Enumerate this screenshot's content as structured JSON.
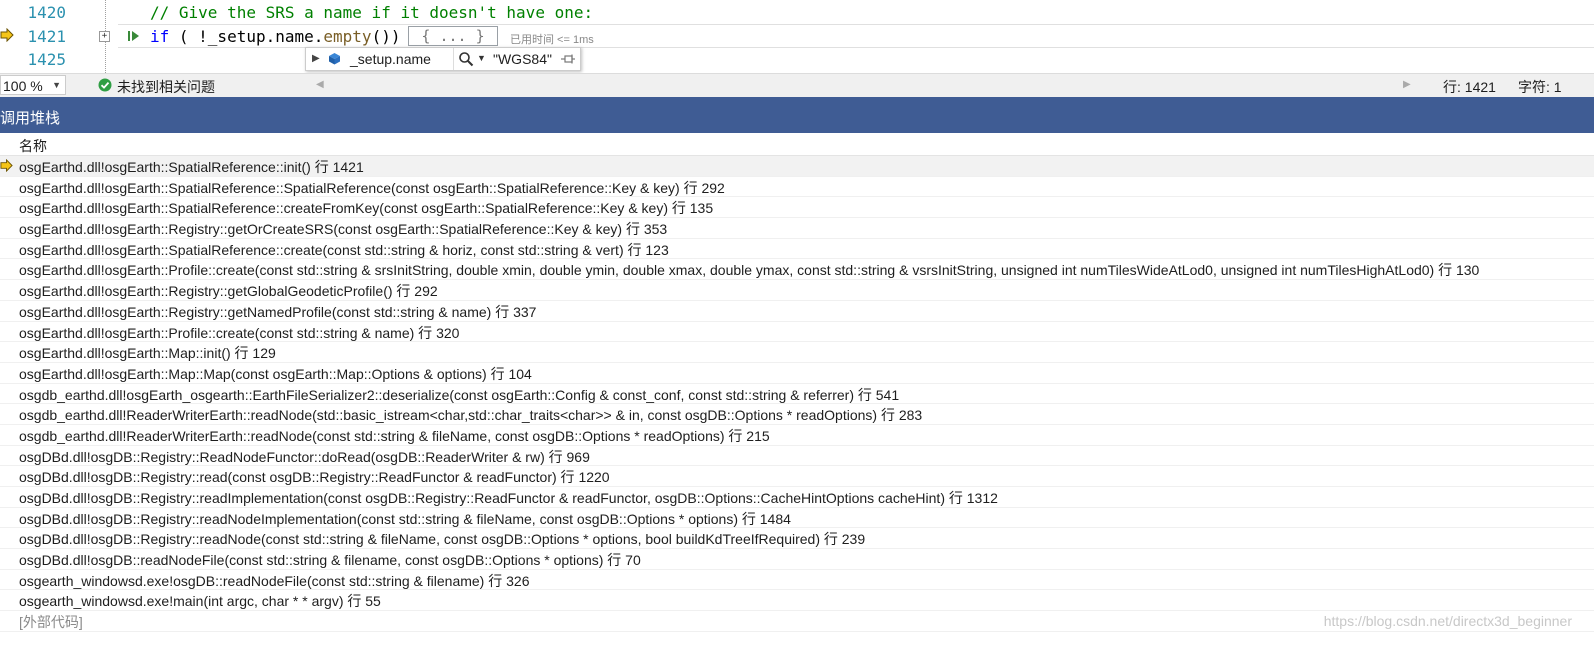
{
  "editor": {
    "lines": [
      {
        "number": "1420",
        "code": "// Give the SRS a name if it doesn't have one:"
      },
      {
        "number": "1421",
        "keyword": "if",
        "code_mid": " ( !_setup.name.",
        "call": "empty",
        "code_end": "())"
      },
      {
        "number": "1425"
      }
    ],
    "collapsed_block": "{ ... }",
    "perf_tip": "已用时间 <= 1ms"
  },
  "datatip": {
    "name": "_setup.name",
    "value": "\"WGS84\""
  },
  "statusbar": {
    "zoom": "100 %",
    "issues": "未找到相关问题",
    "line": "行: 1421",
    "column": "字符: 1"
  },
  "callstack": {
    "title": "调用堆栈",
    "column_header": "名称",
    "frames": [
      "osgEarthd.dll!osgEarth::SpatialReference::init() 行 1421",
      "osgEarthd.dll!osgEarth::SpatialReference::SpatialReference(const osgEarth::SpatialReference::Key & key) 行 292",
      "osgEarthd.dll!osgEarth::SpatialReference::createFromKey(const osgEarth::SpatialReference::Key & key) 行 135",
      "osgEarthd.dll!osgEarth::Registry::getOrCreateSRS(const osgEarth::SpatialReference::Key & key) 行 353",
      "osgEarthd.dll!osgEarth::SpatialReference::create(const std::string & horiz, const std::string & vert) 行 123",
      "osgEarthd.dll!osgEarth::Profile::create(const std::string & srsInitString, double xmin, double ymin, double xmax, double ymax, const std::string & vsrsInitString, unsigned int numTilesWideAtLod0, unsigned int numTilesHighAtLod0) 行 130",
      "osgEarthd.dll!osgEarth::Registry::getGlobalGeodeticProfile() 行 292",
      "osgEarthd.dll!osgEarth::Registry::getNamedProfile(const std::string & name) 行 337",
      "osgEarthd.dll!osgEarth::Profile::create(const std::string & name) 行 320",
      "osgEarthd.dll!osgEarth::Map::init() 行 129",
      "osgEarthd.dll!osgEarth::Map::Map(const osgEarth::Map::Options & options) 行 104",
      "osgdb_earthd.dll!osgEarth_osgearth::EarthFileSerializer2::deserialize(const osgEarth::Config & const_conf, const std::string & referrer) 行 541",
      "osgdb_earthd.dll!ReaderWriterEarth::readNode(std::basic_istream<char,std::char_traits<char>> & in, const osgDB::Options * readOptions) 行 283",
      "osgdb_earthd.dll!ReaderWriterEarth::readNode(const std::string & fileName, const osgDB::Options * readOptions) 行 215",
      "osgDBd.dll!osgDB::Registry::ReadNodeFunctor::doRead(osgDB::ReaderWriter & rw) 行 969",
      "osgDBd.dll!osgDB::Registry::read(const osgDB::Registry::ReadFunctor & readFunctor) 行 1220",
      "osgDBd.dll!osgDB::Registry::readImplementation(const osgDB::Registry::ReadFunctor & readFunctor, osgDB::Options::CacheHintOptions cacheHint) 行 1312",
      "osgDBd.dll!osgDB::Registry::readNodeImplementation(const std::string & fileName, const osgDB::Options * options) 行 1484",
      "osgDBd.dll!osgDB::Registry::readNode(const std::string & fileName, const osgDB::Options * options, bool buildKdTreeIfRequired) 行 239",
      "osgDBd.dll!osgDB::readNodeFile(const std::string & filename, const osgDB::Options * options) 行 70",
      "osgearth_windowsd.exe!osgDB::readNodeFile(const std::string & filename) 行 326",
      "osgearth_windowsd.exe!main(int argc, char * * argv) 行 55",
      "[外部代码]"
    ]
  },
  "watermark": "https://blog.csdn.net/directx3d_beginner",
  "colors": {
    "panel_title_bg": "#3f5c94",
    "line_number": "#2b91af",
    "comment": "#008000",
    "keyword": "#0000ff",
    "current_frame_arrow": "#f5c518"
  }
}
